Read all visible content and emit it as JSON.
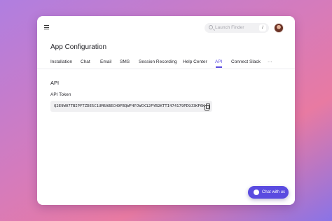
{
  "header": {
    "search_placeholder": "Launch Finder",
    "search_shortcut": "/"
  },
  "page": {
    "title": "App Configuration"
  },
  "tabs": [
    {
      "label": "Installation",
      "active": false
    },
    {
      "label": "Chat",
      "active": false
    },
    {
      "label": "Email",
      "active": false
    },
    {
      "label": "SMS",
      "active": false
    },
    {
      "label": "Session Recording",
      "active": false
    },
    {
      "label": "Help Center",
      "active": false
    },
    {
      "label": "API",
      "active": true
    },
    {
      "label": "Connect Slack",
      "active": false
    },
    {
      "label": "···",
      "active": false
    }
  ],
  "api_section": {
    "title": "API",
    "token_label": "API Token",
    "token_value": "Q2E9W07TBIPFTZDE5C1UM6ABECH9FBQWF4PJWCK12FYB2KTTI474179PD9J3KF6K"
  },
  "chat_widget": {
    "label": "Chat with us"
  },
  "colors": {
    "accent": "#5a4be0",
    "background_gradient": [
      "#b07ee0",
      "#e87aa2",
      "#8a73e6"
    ]
  },
  "icons": {
    "menu": "hamburger-menu-icon",
    "search": "search-icon",
    "copy": "copy-icon",
    "chat": "chat-bubble-icon"
  }
}
